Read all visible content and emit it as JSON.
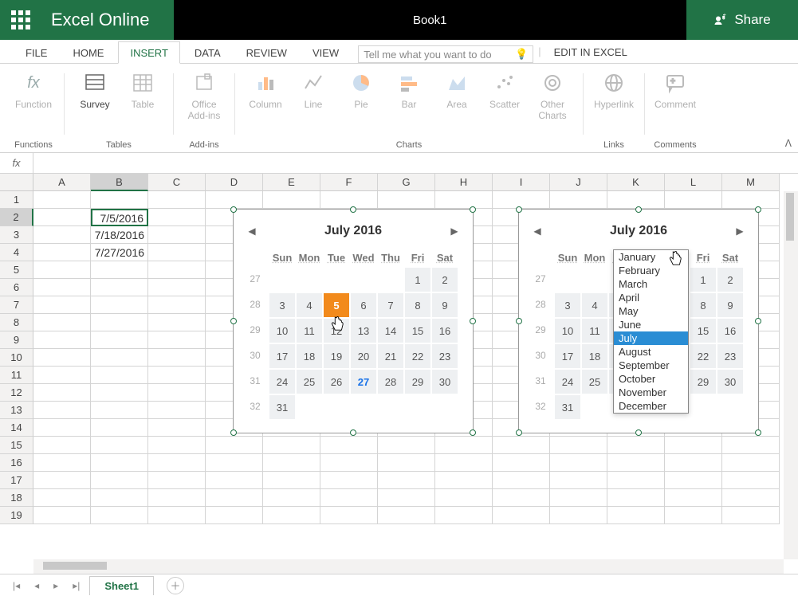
{
  "app": {
    "name": "Excel Online",
    "doc": "Book1",
    "share": "Share"
  },
  "menu": {
    "tabs": [
      "FILE",
      "HOME",
      "INSERT",
      "DATA",
      "REVIEW",
      "VIEW"
    ],
    "active": "INSERT",
    "tellme_placeholder": "Tell me what you want to do",
    "edit_excel": "EDIT IN EXCEL"
  },
  "ribbon": {
    "function": "Function",
    "survey": "Survey",
    "table": "Table",
    "office": "Office\nAdd-ins",
    "column": "Column",
    "line": "Line",
    "pie": "Pie",
    "bar": "Bar",
    "area": "Area",
    "scatter": "Scatter",
    "other": "Other\nCharts",
    "hyperlink": "Hyperlink",
    "comment": "Comment",
    "groups": {
      "functions": "Functions",
      "tables": "Tables",
      "addins": "Add-ins",
      "charts": "Charts",
      "links": "Links",
      "comments": "Comments"
    }
  },
  "cells": {
    "B2": "7/5/2016",
    "B3": "7/18/2016",
    "B4": "7/27/2016"
  },
  "cols": [
    "A",
    "B",
    "C",
    "D",
    "E",
    "F",
    "G",
    "H",
    "I",
    "J",
    "K",
    "L",
    "M"
  ],
  "rowcount": 19,
  "selected_cell": {
    "row": 2,
    "col": "B"
  },
  "calendar": {
    "title": "July 2016",
    "dow": [
      "Sun",
      "Mon",
      "Tue",
      "Wed",
      "Thu",
      "Fri",
      "Sat"
    ],
    "weeks": [
      27,
      28,
      29,
      30,
      31,
      32
    ],
    "days": [
      [
        "",
        "",
        "",
        "",
        "",
        "1",
        "2"
      ],
      [
        "3",
        "4",
        "5",
        "6",
        "7",
        "8",
        "9"
      ],
      [
        "10",
        "11",
        "12",
        "13",
        "14",
        "15",
        "16"
      ],
      [
        "17",
        "18",
        "19",
        "20",
        "21",
        "22",
        "23"
      ],
      [
        "24",
        "25",
        "26",
        "27",
        "28",
        "29",
        "30"
      ],
      [
        "31",
        "",
        "",
        "",
        "",
        "",
        ""
      ]
    ],
    "selected_day": "5",
    "active_day": "27"
  },
  "months": [
    "January",
    "February",
    "March",
    "April",
    "May",
    "June",
    "July",
    "August",
    "September",
    "October",
    "November",
    "December"
  ],
  "months_selected": "July",
  "sheet": "Sheet1"
}
